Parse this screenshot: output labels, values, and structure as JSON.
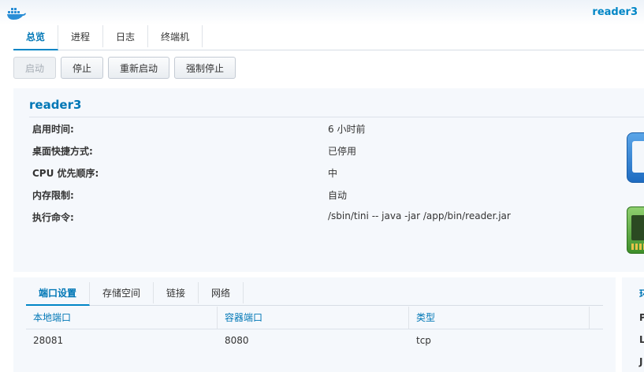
{
  "window": {
    "title": "reader3"
  },
  "tabs": [
    {
      "label": "总览",
      "active": true
    },
    {
      "label": "进程",
      "active": false
    },
    {
      "label": "日志",
      "active": false
    },
    {
      "label": "终端机",
      "active": false
    }
  ],
  "toolbar": {
    "start_label": "启动",
    "stop_label": "停止",
    "restart_label": "重新启动",
    "force_stop_label": "强制停止"
  },
  "info": {
    "container_name": "reader3",
    "rows": [
      {
        "label": "启用时间:",
        "value": "6 小时前"
      },
      {
        "label": "桌面快捷方式:",
        "value": "已停用"
      },
      {
        "label": "CPU 优先顺序:",
        "value": "中"
      },
      {
        "label": "内存限制:",
        "value": "自动"
      },
      {
        "label": "执行命令:",
        "value": "/sbin/tini -- java -jar /app/bin/reader.jar"
      }
    ]
  },
  "bottom": {
    "tabs": [
      {
        "label": "端口设置",
        "active": true
      },
      {
        "label": "存储空间",
        "active": false
      },
      {
        "label": "链接",
        "active": false
      },
      {
        "label": "网络",
        "active": false
      }
    ],
    "columns": [
      "本地端口",
      "容器端口",
      "类型"
    ],
    "rows": [
      {
        "local": "28081",
        "container": "8080",
        "type": "tcp"
      }
    ]
  },
  "right_panel": {
    "fragments": [
      "环",
      "P",
      "L",
      "J"
    ]
  },
  "colors": {
    "accent": "#0086c6",
    "panel_bg": "#f5f8fc"
  },
  "icons": [
    "docker-whale-icon",
    "monitor-icon",
    "memory-icon"
  ]
}
